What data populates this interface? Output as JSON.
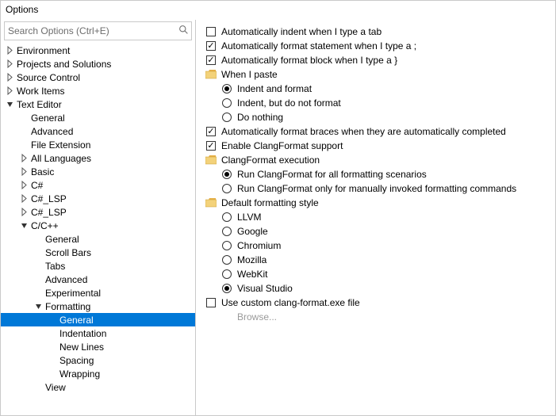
{
  "window": {
    "title": "Options"
  },
  "search": {
    "placeholder": "Search Options (Ctrl+E)"
  },
  "tree": [
    {
      "level": 0,
      "arrow": "closed",
      "label": "Environment"
    },
    {
      "level": 0,
      "arrow": "closed",
      "label": "Projects and Solutions"
    },
    {
      "level": 0,
      "arrow": "closed",
      "label": "Source Control"
    },
    {
      "level": 0,
      "arrow": "closed",
      "label": "Work Items"
    },
    {
      "level": 0,
      "arrow": "open",
      "label": "Text Editor"
    },
    {
      "level": 1,
      "arrow": "none",
      "label": "General"
    },
    {
      "level": 1,
      "arrow": "none",
      "label": "Advanced"
    },
    {
      "level": 1,
      "arrow": "none",
      "label": "File Extension"
    },
    {
      "level": 1,
      "arrow": "closed",
      "label": "All Languages"
    },
    {
      "level": 1,
      "arrow": "closed",
      "label": "Basic"
    },
    {
      "level": 1,
      "arrow": "closed",
      "label": "C#"
    },
    {
      "level": 1,
      "arrow": "closed",
      "label": "C#_LSP"
    },
    {
      "level": 1,
      "arrow": "closed",
      "label": "C#_LSP"
    },
    {
      "level": 1,
      "arrow": "open",
      "label": "C/C++"
    },
    {
      "level": 2,
      "arrow": "none",
      "label": "General"
    },
    {
      "level": 2,
      "arrow": "none",
      "label": "Scroll Bars"
    },
    {
      "level": 2,
      "arrow": "none",
      "label": "Tabs"
    },
    {
      "level": 2,
      "arrow": "none",
      "label": "Advanced"
    },
    {
      "level": 2,
      "arrow": "none",
      "label": "Experimental"
    },
    {
      "level": 2,
      "arrow": "open",
      "label": "Formatting"
    },
    {
      "level": 3,
      "arrow": "none",
      "label": "General",
      "selected": true
    },
    {
      "level": 3,
      "arrow": "none",
      "label": "Indentation"
    },
    {
      "level": 3,
      "arrow": "none",
      "label": "New Lines"
    },
    {
      "level": 3,
      "arrow": "none",
      "label": "Spacing"
    },
    {
      "level": 3,
      "arrow": "none",
      "label": "Wrapping"
    },
    {
      "level": 2,
      "arrow": "none",
      "label": "View"
    }
  ],
  "options": [
    {
      "indent": 0,
      "kind": "checkbox",
      "checked": false,
      "label": "Automatically indent when I type a tab"
    },
    {
      "indent": 0,
      "kind": "checkbox",
      "checked": true,
      "label": "Automatically format statement when I type a ;"
    },
    {
      "indent": 0,
      "kind": "checkbox",
      "checked": true,
      "label": "Automatically format block when I type a }"
    },
    {
      "indent": 0,
      "kind": "folder",
      "label": "When I paste"
    },
    {
      "indent": 1,
      "kind": "radio",
      "checked": true,
      "label": "Indent and format"
    },
    {
      "indent": 1,
      "kind": "radio",
      "checked": false,
      "label": "Indent, but do not format"
    },
    {
      "indent": 1,
      "kind": "radio",
      "checked": false,
      "label": "Do nothing"
    },
    {
      "indent": 0,
      "kind": "checkbox",
      "checked": true,
      "label": "Automatically format braces when they are automatically completed"
    },
    {
      "indent": 0,
      "kind": "checkbox",
      "checked": true,
      "label": "Enable ClangFormat support"
    },
    {
      "indent": 0,
      "kind": "folder",
      "label": "ClangFormat execution"
    },
    {
      "indent": 1,
      "kind": "radio",
      "checked": true,
      "label": "Run ClangFormat for all formatting scenarios"
    },
    {
      "indent": 1,
      "kind": "radio",
      "checked": false,
      "label": "Run ClangFormat only for manually invoked formatting commands"
    },
    {
      "indent": 0,
      "kind": "folder",
      "label": "Default formatting style"
    },
    {
      "indent": 1,
      "kind": "radio",
      "checked": false,
      "label": "LLVM"
    },
    {
      "indent": 1,
      "kind": "radio",
      "checked": false,
      "label": "Google"
    },
    {
      "indent": 1,
      "kind": "radio",
      "checked": false,
      "label": "Chromium"
    },
    {
      "indent": 1,
      "kind": "radio",
      "checked": false,
      "label": "Mozilla"
    },
    {
      "indent": 1,
      "kind": "radio",
      "checked": false,
      "label": "WebKit"
    },
    {
      "indent": 1,
      "kind": "radio",
      "checked": true,
      "label": "Visual Studio"
    },
    {
      "indent": 0,
      "kind": "checkbox",
      "checked": false,
      "label": "Use custom clang-format.exe file"
    },
    {
      "indent": 1,
      "kind": "text",
      "disabled": true,
      "label": "Browse..."
    }
  ]
}
